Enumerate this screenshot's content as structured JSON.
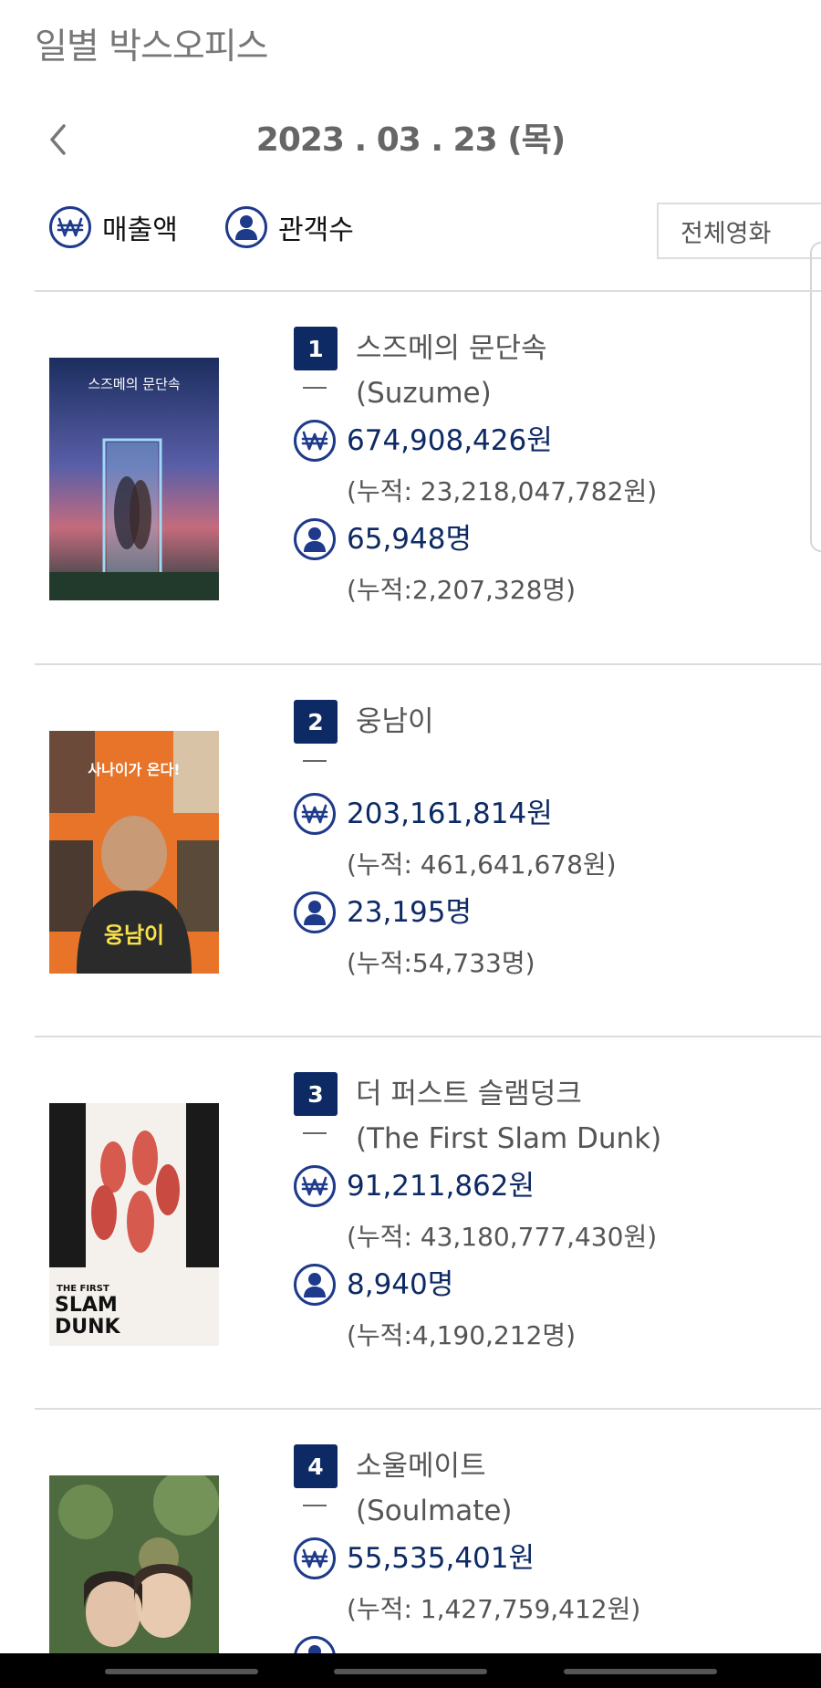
{
  "page": {
    "title": "일별 박스오피스"
  },
  "date_bar": {
    "date": "2023 . 03 . 23  (목)"
  },
  "toolbar": {
    "revenue_label": "매출액",
    "audience_label": "관객수",
    "filter_value": "전체영화"
  },
  "movies": [
    {
      "rank": "1",
      "title_ko": "스즈메의 문단속",
      "title_en": "(Suzume)",
      "revenue": "674,908,426원",
      "revenue_cum": "(누적: 23,218,047,782원)",
      "audience": "65,948명",
      "audience_cum": "(누적:2,207,328명)"
    },
    {
      "rank": "2",
      "title_ko": "웅남이",
      "title_en": "",
      "revenue": "203,161,814원",
      "revenue_cum": "(누적: 461,641,678원)",
      "audience": "23,195명",
      "audience_cum": "(누적:54,733명)"
    },
    {
      "rank": "3",
      "title_ko": "더 퍼스트 슬램덩크",
      "title_en": "(The First Slam Dunk)",
      "revenue": "91,211,862원",
      "revenue_cum": "(누적: 43,180,777,430원)",
      "audience": "8,940명",
      "audience_cum": "(누적:4,190,212명)"
    },
    {
      "rank": "4",
      "title_ko": "소울메이트",
      "title_en": "(Soulmate)",
      "revenue": "55,535,401원",
      "revenue_cum": "(누적: 1,427,759,412원)",
      "audience": "",
      "audience_cum": ""
    }
  ],
  "posters": {
    "suzume_title": "스즈메의 문단속",
    "woongnami_tagline": "사나이가 온다!",
    "woongnami_title": "웅남이",
    "slamdunk_title_1": "THE FIRST",
    "slamdunk_title_2": "SLAM",
    "slamdunk_title_3": "DUNK"
  },
  "icons": {
    "revenue": "won-coin-icon",
    "audience": "person-icon",
    "back": "chevron-left-icon"
  },
  "colors": {
    "accent_navy": "#0d2a64",
    "icon_blue": "#1e3a8a"
  }
}
